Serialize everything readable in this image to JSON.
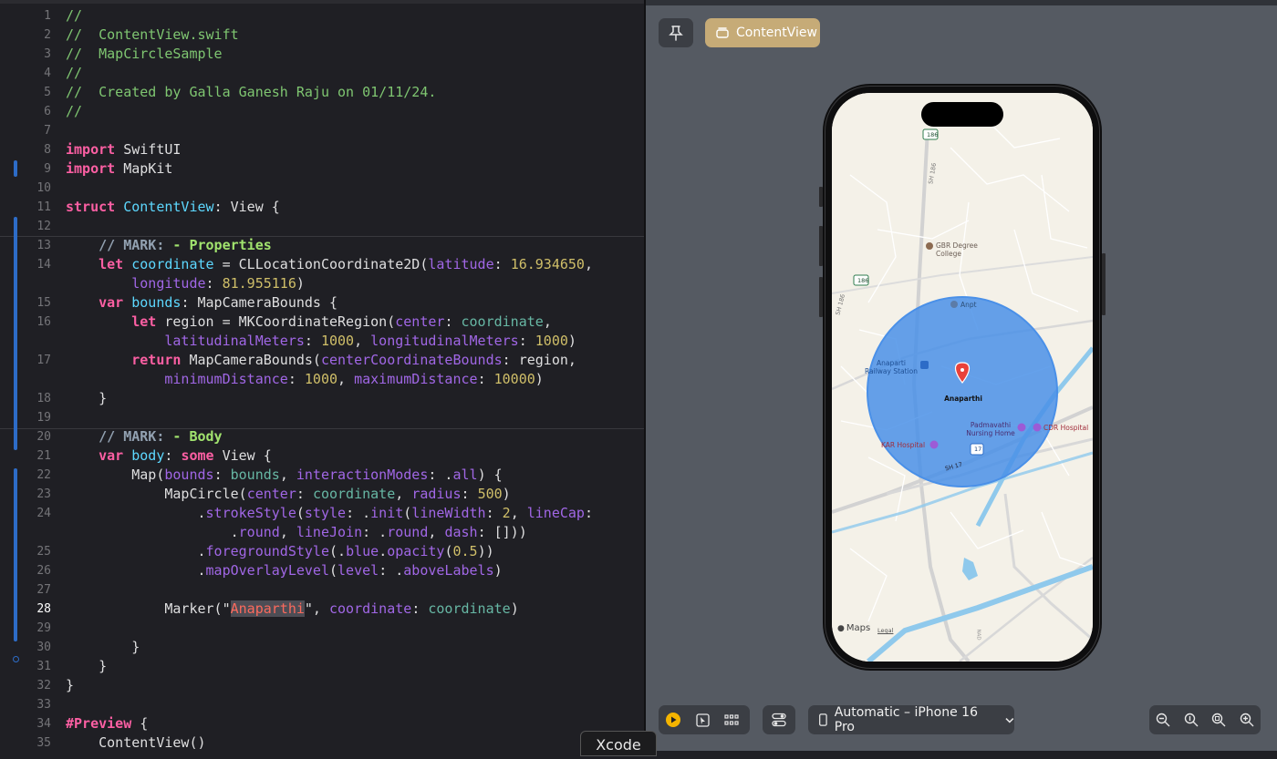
{
  "editor": {
    "lines": [
      {
        "n": "1",
        "t": [
          [
            "c-com",
            "//"
          ]
        ]
      },
      {
        "n": "2",
        "t": [
          [
            "c-com",
            "//  ContentView.swift"
          ]
        ]
      },
      {
        "n": "3",
        "t": [
          [
            "c-com",
            "//  MapCircleSample"
          ]
        ]
      },
      {
        "n": "4",
        "t": [
          [
            "c-com",
            "//"
          ]
        ]
      },
      {
        "n": "5",
        "t": [
          [
            "c-com",
            "//  Created by Galla Ganesh Raju on 01/11/24."
          ]
        ]
      },
      {
        "n": "6",
        "t": [
          [
            "c-com",
            "//"
          ]
        ]
      },
      {
        "n": "7",
        "t": []
      },
      {
        "n": "8",
        "t": [
          [
            "c-kw",
            "import"
          ],
          [
            "c-pl",
            " SwiftUI"
          ]
        ]
      },
      {
        "n": "9",
        "t": [
          [
            "c-kw",
            "import"
          ],
          [
            "c-pl",
            " MapKit"
          ]
        ]
      },
      {
        "n": "10",
        "t": []
      },
      {
        "n": "11",
        "t": [
          [
            "c-kw",
            "struct"
          ],
          [
            "c-pl",
            " "
          ],
          [
            "c-ty",
            "ContentView"
          ],
          [
            "c-pl",
            ": View {"
          ]
        ]
      },
      {
        "n": "12",
        "t": []
      },
      {
        "n": "13",
        "t": [
          [
            "c-pl",
            "    "
          ],
          [
            "c-mark",
            "// MARK: "
          ],
          [
            "c-mark2",
            "- Properties"
          ]
        ]
      },
      {
        "n": "14",
        "t": [
          [
            "c-pl",
            "    "
          ],
          [
            "c-kw",
            "let"
          ],
          [
            "c-pl",
            " "
          ],
          [
            "c-ty",
            "coordinate"
          ],
          [
            "c-pl",
            " = CLLocationCoordinate2D("
          ],
          [
            "c-fn",
            "latitude"
          ],
          [
            "c-pl",
            ": "
          ],
          [
            "c-num",
            "16.934650"
          ],
          [
            "c-pl",
            ","
          ]
        ]
      },
      {
        "n": "",
        "t": [
          [
            "c-pl",
            "        "
          ],
          [
            "c-fn",
            "longitude"
          ],
          [
            "c-pl",
            ": "
          ],
          [
            "c-num",
            "81.955116"
          ],
          [
            "c-pl",
            ")"
          ]
        ]
      },
      {
        "n": "15",
        "t": [
          [
            "c-pl",
            "    "
          ],
          [
            "c-kw",
            "var"
          ],
          [
            "c-pl",
            " "
          ],
          [
            "c-ty",
            "bounds"
          ],
          [
            "c-pl",
            ": MapCameraBounds {"
          ]
        ]
      },
      {
        "n": "16",
        "t": [
          [
            "c-pl",
            "        "
          ],
          [
            "c-kw",
            "let"
          ],
          [
            "c-pl",
            " region = MKCoordinateRegion("
          ],
          [
            "c-fn",
            "center"
          ],
          [
            "c-pl",
            ": "
          ],
          [
            "c-prop",
            "coordinate"
          ],
          [
            "c-pl",
            ","
          ]
        ]
      },
      {
        "n": "",
        "t": [
          [
            "c-pl",
            "            "
          ],
          [
            "c-fn",
            "latitudinalMeters"
          ],
          [
            "c-pl",
            ": "
          ],
          [
            "c-num",
            "1000"
          ],
          [
            "c-pl",
            ", "
          ],
          [
            "c-fn",
            "longitudinalMeters"
          ],
          [
            "c-pl",
            ": "
          ],
          [
            "c-num",
            "1000"
          ],
          [
            "c-pl",
            ")"
          ]
        ]
      },
      {
        "n": "17",
        "t": [
          [
            "c-pl",
            "        "
          ],
          [
            "c-kw",
            "return"
          ],
          [
            "c-pl",
            " MapCameraBounds("
          ],
          [
            "c-fn",
            "centerCoordinateBounds"
          ],
          [
            "c-pl",
            ": region,"
          ]
        ]
      },
      {
        "n": "",
        "t": [
          [
            "c-pl",
            "            "
          ],
          [
            "c-fn",
            "minimumDistance"
          ],
          [
            "c-pl",
            ": "
          ],
          [
            "c-num",
            "1000"
          ],
          [
            "c-pl",
            ", "
          ],
          [
            "c-fn",
            "maximumDistance"
          ],
          [
            "c-pl",
            ": "
          ],
          [
            "c-num",
            "10000"
          ],
          [
            "c-pl",
            ")"
          ]
        ]
      },
      {
        "n": "18",
        "t": [
          [
            "c-pl",
            "    }"
          ]
        ]
      },
      {
        "n": "19",
        "t": []
      },
      {
        "n": "20",
        "t": [
          [
            "c-pl",
            "    "
          ],
          [
            "c-mark",
            "// MARK: "
          ],
          [
            "c-mark2",
            "- Body"
          ]
        ]
      },
      {
        "n": "21",
        "t": [
          [
            "c-pl",
            "    "
          ],
          [
            "c-kw",
            "var"
          ],
          [
            "c-pl",
            " "
          ],
          [
            "c-ty",
            "body"
          ],
          [
            "c-pl",
            ": "
          ],
          [
            "c-kw",
            "some"
          ],
          [
            "c-pl",
            " View {"
          ]
        ]
      },
      {
        "n": "22",
        "t": [
          [
            "c-pl",
            "        Map("
          ],
          [
            "c-fn",
            "bounds"
          ],
          [
            "c-pl",
            ": "
          ],
          [
            "c-prop",
            "bounds"
          ],
          [
            "c-pl",
            ", "
          ],
          [
            "c-fn",
            "interactionModes"
          ],
          [
            "c-pl",
            ": ."
          ],
          [
            "c-fn",
            "all"
          ],
          [
            "c-pl",
            ") {"
          ]
        ]
      },
      {
        "n": "23",
        "t": [
          [
            "c-pl",
            "            MapCircle("
          ],
          [
            "c-fn",
            "center"
          ],
          [
            "c-pl",
            ": "
          ],
          [
            "c-prop",
            "coordinate"
          ],
          [
            "c-pl",
            ", "
          ],
          [
            "c-fn",
            "radius"
          ],
          [
            "c-pl",
            ": "
          ],
          [
            "c-num",
            "500"
          ],
          [
            "c-pl",
            ")"
          ]
        ]
      },
      {
        "n": "24",
        "t": [
          [
            "c-pl",
            "                ."
          ],
          [
            "c-fn",
            "strokeStyle"
          ],
          [
            "c-pl",
            "("
          ],
          [
            "c-fn",
            "style"
          ],
          [
            "c-pl",
            ": ."
          ],
          [
            "c-fn",
            "init"
          ],
          [
            "c-pl",
            "("
          ],
          [
            "c-fn",
            "lineWidth"
          ],
          [
            "c-pl",
            ": "
          ],
          [
            "c-num",
            "2"
          ],
          [
            "c-pl",
            ", "
          ],
          [
            "c-fn",
            "lineCap"
          ],
          [
            "c-pl",
            ":"
          ]
        ]
      },
      {
        "n": "",
        "t": [
          [
            "c-pl",
            "                    ."
          ],
          [
            "c-fn",
            "round"
          ],
          [
            "c-pl",
            ", "
          ],
          [
            "c-fn",
            "lineJoin"
          ],
          [
            "c-pl",
            ": ."
          ],
          [
            "c-fn",
            "round"
          ],
          [
            "c-pl",
            ", "
          ],
          [
            "c-fn",
            "dash"
          ],
          [
            "c-pl",
            ": []))"
          ]
        ]
      },
      {
        "n": "25",
        "t": [
          [
            "c-pl",
            "                ."
          ],
          [
            "c-fn",
            "foregroundStyle"
          ],
          [
            "c-pl",
            "(."
          ],
          [
            "c-fn",
            "blue"
          ],
          [
            "c-pl",
            "."
          ],
          [
            "c-fn",
            "opacity"
          ],
          [
            "c-pl",
            "("
          ],
          [
            "c-num",
            "0.5"
          ],
          [
            "c-pl",
            "))"
          ]
        ]
      },
      {
        "n": "26",
        "t": [
          [
            "c-pl",
            "                ."
          ],
          [
            "c-fn",
            "mapOverlayLevel"
          ],
          [
            "c-pl",
            "("
          ],
          [
            "c-fn",
            "level"
          ],
          [
            "c-pl",
            ": ."
          ],
          [
            "c-fn",
            "aboveLabels"
          ],
          [
            "c-pl",
            ")"
          ]
        ]
      },
      {
        "n": "27",
        "t": []
      },
      {
        "n": "28",
        "cur": true,
        "t": [
          [
            "c-pl",
            "            Marker(\""
          ],
          [
            "c-str hl",
            "Anaparthi"
          ],
          [
            "c-pl",
            "\", "
          ],
          [
            "c-fn",
            "coordinate"
          ],
          [
            "c-pl",
            ": "
          ],
          [
            "c-prop",
            "coordinate"
          ],
          [
            "c-pl",
            ")"
          ]
        ]
      },
      {
        "n": "29",
        "t": []
      },
      {
        "n": "30",
        "t": [
          [
            "c-pl",
            "        }"
          ]
        ]
      },
      {
        "n": "31",
        "t": [
          [
            "c-pl",
            "    }"
          ]
        ]
      },
      {
        "n": "32",
        "t": [
          [
            "c-pl",
            "}"
          ]
        ]
      },
      {
        "n": "33",
        "t": []
      },
      {
        "n": "34",
        "t": [
          [
            "c-kw",
            "#Preview"
          ],
          [
            "c-pl",
            " {"
          ]
        ]
      },
      {
        "n": "35",
        "t": [
          [
            "c-pl",
            "    ContentView()"
          ]
        ]
      }
    ]
  },
  "preview": {
    "pin_icon": "pin-icon",
    "content_view_label": "ContentView",
    "device_label": "Automatic – iPhone 16 Pro",
    "map": {
      "marker_label": "Anaparthi",
      "labels": {
        "gbr_college": "GBR Degree College",
        "anpt": "Anpt",
        "railway_station": "Anaparti Railway Station",
        "padmavathi": "Padmavathi Nursing Home",
        "cdr_hospital": "CDR Hospital",
        "kar_hospital": "KAR Hospital",
        "sh17": "SH 17",
        "sh186_a": "SH 186",
        "sh186_b": "SH 186",
        "shield_186_a": "186",
        "shield_186_b": "186",
        "shield_17": "17",
        "maps_brand": "Maps",
        "legal": "Legal",
        "road_bottom": "NAD"
      },
      "circle_color": "#4a90e8",
      "marker_color": "#e8423b"
    }
  },
  "taskbar": {
    "xcode_label": "Xcode"
  }
}
